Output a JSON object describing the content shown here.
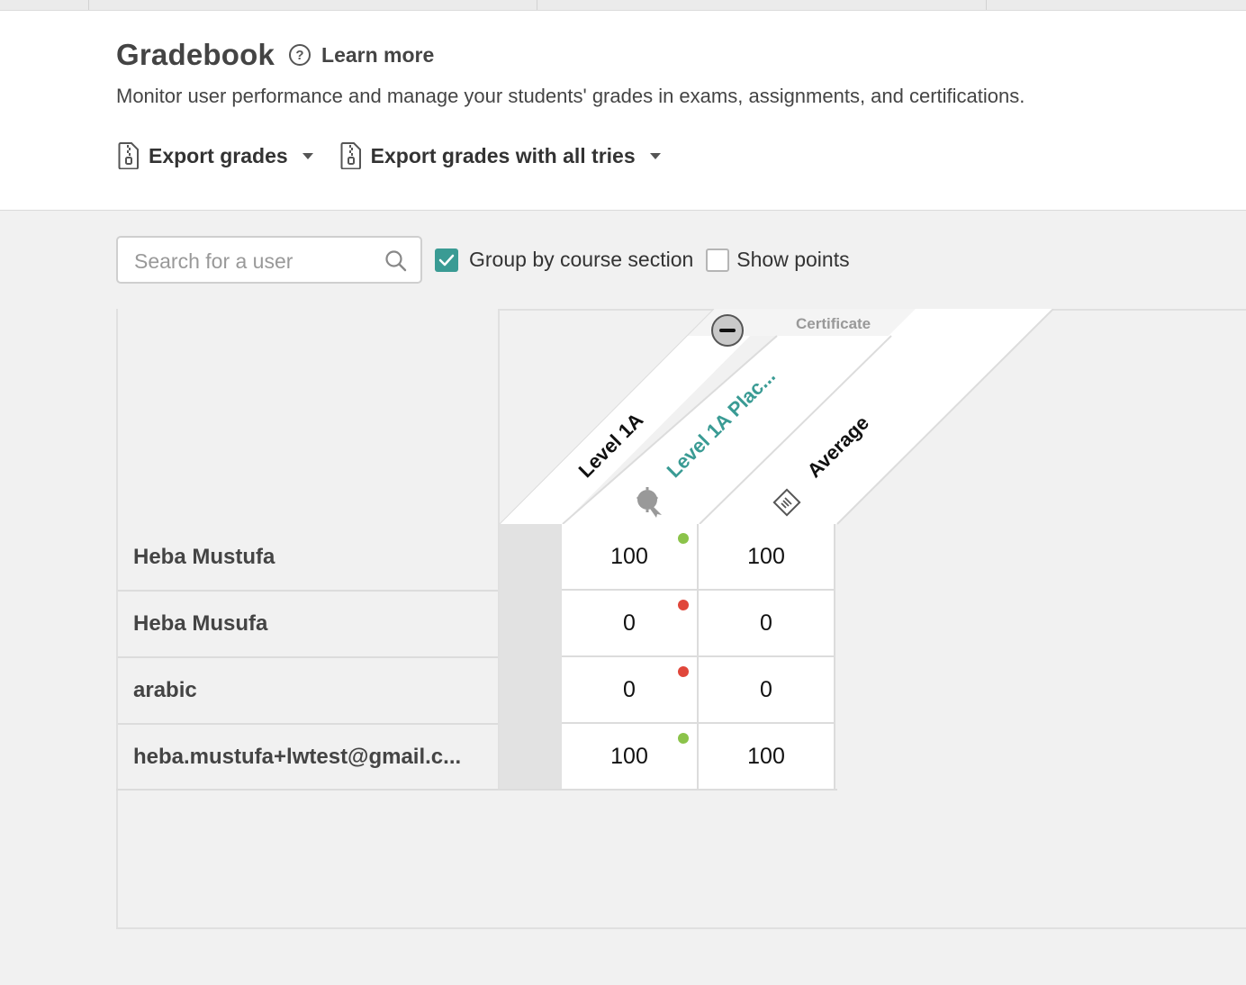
{
  "header": {
    "title": "Gradebook",
    "help_label": "Learn more",
    "subtitle": "Monitor user performance and manage your students' grades in exams, assignments, and certifications."
  },
  "exports": [
    {
      "label": "Export grades",
      "icon": "zip-file-icon"
    },
    {
      "label": "Export grades with all tries",
      "icon": "zip-file-icon"
    }
  ],
  "controls": {
    "search_placeholder": "Search for a user",
    "search_value": "",
    "group_by_section": {
      "label": "Group by course section",
      "checked": true
    },
    "show_points": {
      "label": "Show points",
      "checked": false
    }
  },
  "grid": {
    "section_label": "Certificate",
    "columns": [
      {
        "label": "Level 1A",
        "type": "section"
      },
      {
        "label": "Level 1A Plac...",
        "type": "certificate",
        "icon": "certificate-badge-icon"
      },
      {
        "label": "Average",
        "type": "average",
        "icon": "average-icon"
      }
    ],
    "rows": [
      {
        "name": "Heba Mustufa",
        "score": "100",
        "average": "100",
        "status": "pass"
      },
      {
        "name": "Heba Musufa",
        "score": "0",
        "average": "0",
        "status": "fail"
      },
      {
        "name": "arabic",
        "score": "0",
        "average": "0",
        "status": "fail"
      },
      {
        "name": "heba.mustufa+lwtest@gmail.c...",
        "score": "100",
        "average": "100",
        "status": "pass"
      }
    ]
  },
  "colors": {
    "accent": "#3a9b94",
    "pass": "#8bc34a",
    "fail": "#e0463a"
  }
}
